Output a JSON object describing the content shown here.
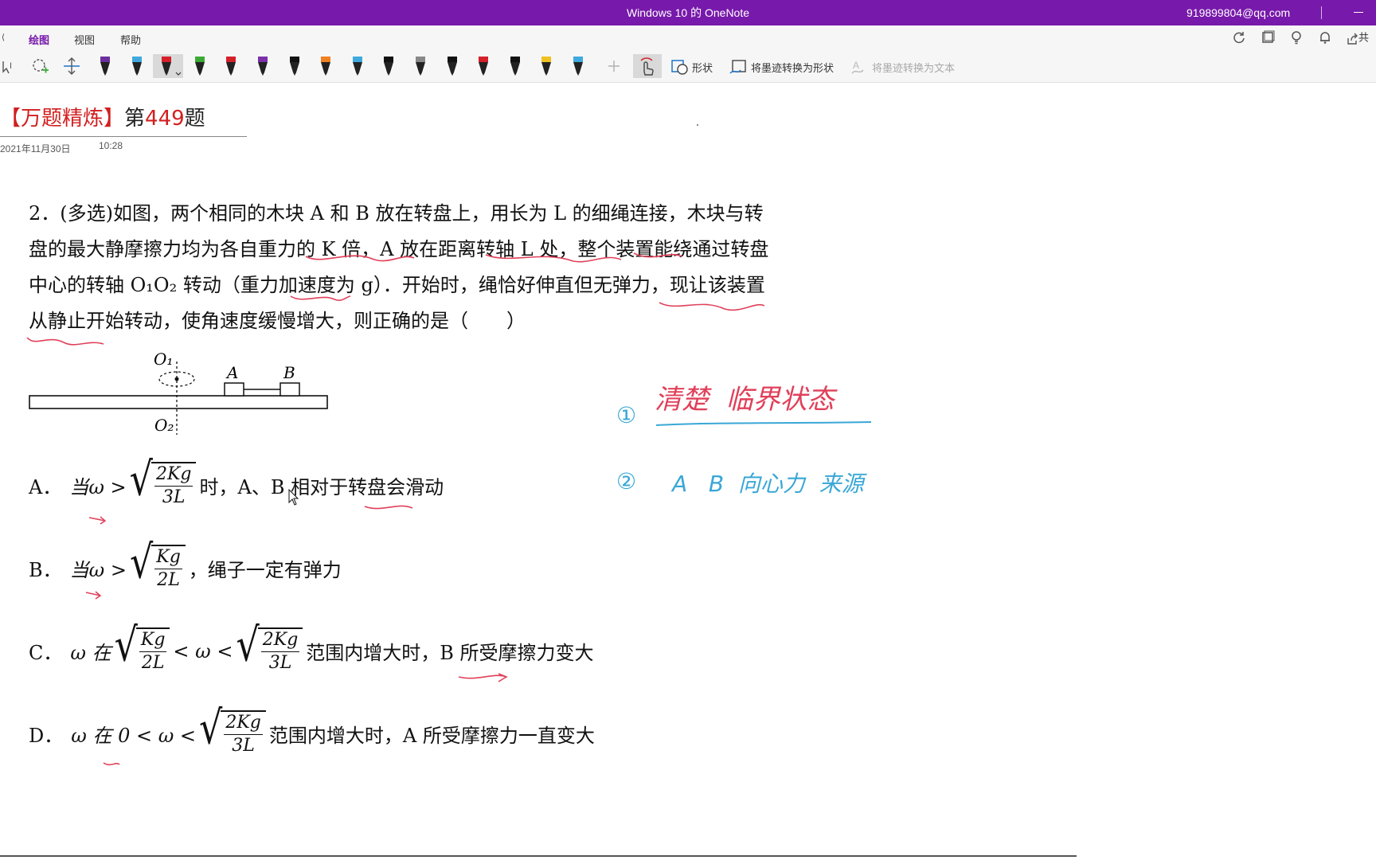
{
  "window": {
    "title": "Windows 10 的 OneNote",
    "account": "919899804@qq.com"
  },
  "ribbon": {
    "tabs": [
      {
        "label": "绘图",
        "active": true
      },
      {
        "label": "视图",
        "active": false
      },
      {
        "label": "帮助",
        "active": false
      }
    ],
    "shapes_label": "形状",
    "ink_to_shape_label": "将墨迹转换为形状",
    "ink_to_text_label": "将墨迹转换为文本",
    "share_label": "共",
    "pen_colors": [
      "#6b2f9e",
      "#3fa9dd",
      "#d32029",
      "#3aaa35",
      "#d32029",
      "#7b2fa8",
      "#111111",
      "#f08020",
      "#3fa9dd",
      "#111111",
      "#888888",
      "#111111",
      "#d32029",
      "#111111",
      "#f0c020",
      "#3fa9dd"
    ]
  },
  "page": {
    "title_bracket": "【万题精炼】",
    "title_prefix": "第",
    "title_number": "449",
    "title_suffix": "题",
    "date": "2021年11月30日",
    "time": "10:28"
  },
  "question": {
    "text": "2．(多选)如图，两个相同的木块 A 和 B 放在转盘上，用长为 L 的细绳连接，木块与转盘的最大静摩擦力均为各自重力的 K 倍，A 放在距离转轴 L 处，整个装置能绕通过转盘中心的转轴 O₁O₂ 转动（重力加速度为 g）．开始时，绳恰好伸直但无弹力，现让该装置从静止开始转动，使角速度缓慢增大，则正确的是（　　）",
    "figure": {
      "o1": "O₁",
      "o2": "O₂",
      "a": "A",
      "b": "B"
    },
    "options": {
      "a": {
        "label": "A．",
        "pre": "当ω >",
        "num": "2Kg",
        "den": "3L",
        "post": "时，A、B 相对于转盘会滑动"
      },
      "b": {
        "label": "B．",
        "pre": "当ω >",
        "num": "Kg",
        "den": "2L",
        "post": "，绳子一定有弹力"
      },
      "c": {
        "label": "C．",
        "pre": "ω 在",
        "num1": "Kg",
        "den1": "2L",
        "mid": "< ω <",
        "num2": "2Kg",
        "den2": "3L",
        "post": "范围内增大时，B 所受摩擦力变大"
      },
      "d": {
        "label": "D．",
        "pre": "ω 在 0 < ω <",
        "num": "2Kg",
        "den": "3L",
        "post": "范围内增大时，A 所受摩擦力一直变大"
      }
    }
  },
  "ink_notes": {
    "note1_num": "①",
    "note1_text": "清楚  临界状态",
    "note2_num": "②",
    "note2_text": "A   B  向心力  来源",
    "red_color": "#e0405a",
    "blue_color": "#3aa7d6"
  }
}
